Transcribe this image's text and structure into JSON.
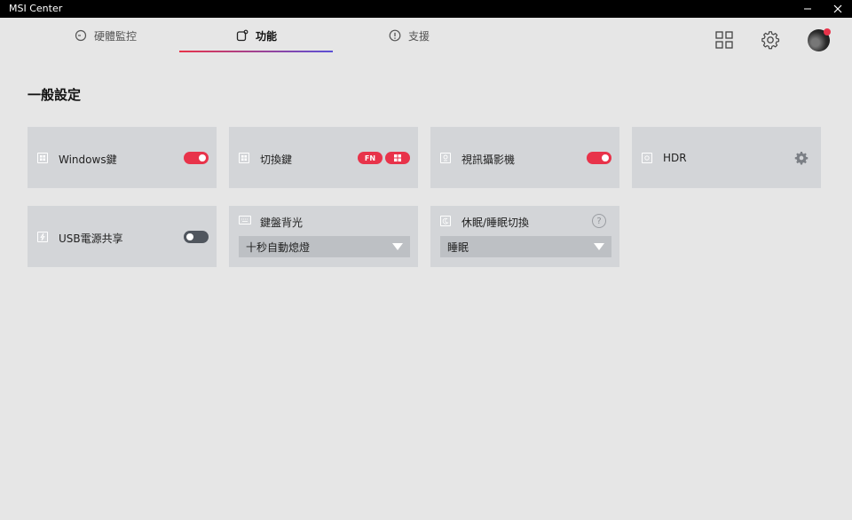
{
  "window": {
    "title": "MSI Center"
  },
  "nav": {
    "tabs": [
      {
        "label": "硬體監控",
        "icon": "gauge-icon"
      },
      {
        "label": "功能",
        "icon": "feature-icon",
        "active": true
      },
      {
        "label": "支援",
        "icon": "alert-icon"
      }
    ]
  },
  "main": {
    "section_title": "一般設定",
    "cards": {
      "windows_key": {
        "label": "Windows鍵",
        "toggle": "on"
      },
      "switch_key": {
        "label": "切換鍵",
        "pill_fn": "FN"
      },
      "webcam": {
        "label": "視訊攝影機",
        "toggle": "on"
      },
      "hdr": {
        "label": "HDR"
      },
      "usb_power": {
        "label": "USB電源共享",
        "toggle": "off"
      },
      "kb_backlight": {
        "label": "鍵盤背光",
        "selected": "十秒自動熄燈"
      },
      "sleep_switch": {
        "label": "休眠/睡眠切換",
        "selected": "睡眠",
        "help": "?"
      }
    }
  },
  "colors": {
    "accent": "#e8334a",
    "accent2": "#5a4fd6",
    "card_bg": "#d3d5d8",
    "bg": "#e6e6e6"
  }
}
